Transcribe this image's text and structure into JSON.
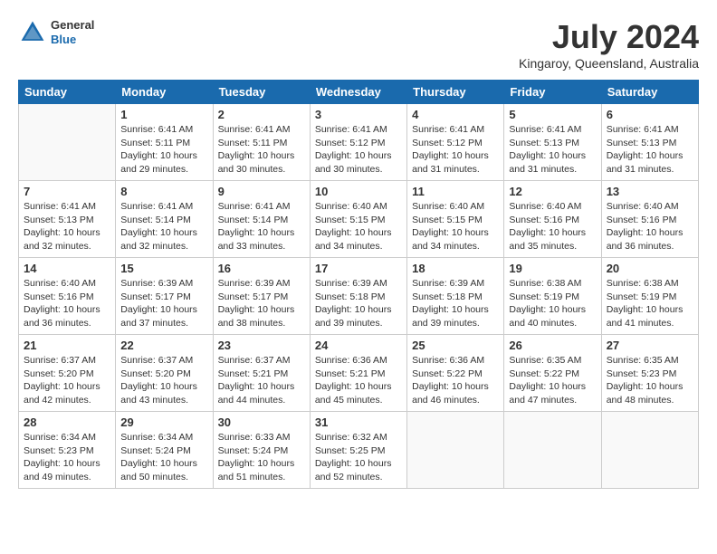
{
  "header": {
    "logo": {
      "general": "General",
      "blue": "Blue"
    },
    "title": "July 2024",
    "location": "Kingaroy, Queensland, Australia"
  },
  "calendar": {
    "days_of_week": [
      "Sunday",
      "Monday",
      "Tuesday",
      "Wednesday",
      "Thursday",
      "Friday",
      "Saturday"
    ],
    "weeks": [
      [
        {
          "day": "",
          "info": ""
        },
        {
          "day": "1",
          "info": "Sunrise: 6:41 AM\nSunset: 5:11 PM\nDaylight: 10 hours\nand 29 minutes."
        },
        {
          "day": "2",
          "info": "Sunrise: 6:41 AM\nSunset: 5:11 PM\nDaylight: 10 hours\nand 30 minutes."
        },
        {
          "day": "3",
          "info": "Sunrise: 6:41 AM\nSunset: 5:12 PM\nDaylight: 10 hours\nand 30 minutes."
        },
        {
          "day": "4",
          "info": "Sunrise: 6:41 AM\nSunset: 5:12 PM\nDaylight: 10 hours\nand 31 minutes."
        },
        {
          "day": "5",
          "info": "Sunrise: 6:41 AM\nSunset: 5:13 PM\nDaylight: 10 hours\nand 31 minutes."
        },
        {
          "day": "6",
          "info": "Sunrise: 6:41 AM\nSunset: 5:13 PM\nDaylight: 10 hours\nand 31 minutes."
        }
      ],
      [
        {
          "day": "7",
          "info": "Sunrise: 6:41 AM\nSunset: 5:13 PM\nDaylight: 10 hours\nand 32 minutes."
        },
        {
          "day": "8",
          "info": "Sunrise: 6:41 AM\nSunset: 5:14 PM\nDaylight: 10 hours\nand 32 minutes."
        },
        {
          "day": "9",
          "info": "Sunrise: 6:41 AM\nSunset: 5:14 PM\nDaylight: 10 hours\nand 33 minutes."
        },
        {
          "day": "10",
          "info": "Sunrise: 6:40 AM\nSunset: 5:15 PM\nDaylight: 10 hours\nand 34 minutes."
        },
        {
          "day": "11",
          "info": "Sunrise: 6:40 AM\nSunset: 5:15 PM\nDaylight: 10 hours\nand 34 minutes."
        },
        {
          "day": "12",
          "info": "Sunrise: 6:40 AM\nSunset: 5:16 PM\nDaylight: 10 hours\nand 35 minutes."
        },
        {
          "day": "13",
          "info": "Sunrise: 6:40 AM\nSunset: 5:16 PM\nDaylight: 10 hours\nand 36 minutes."
        }
      ],
      [
        {
          "day": "14",
          "info": "Sunrise: 6:40 AM\nSunset: 5:16 PM\nDaylight: 10 hours\nand 36 minutes."
        },
        {
          "day": "15",
          "info": "Sunrise: 6:39 AM\nSunset: 5:17 PM\nDaylight: 10 hours\nand 37 minutes."
        },
        {
          "day": "16",
          "info": "Sunrise: 6:39 AM\nSunset: 5:17 PM\nDaylight: 10 hours\nand 38 minutes."
        },
        {
          "day": "17",
          "info": "Sunrise: 6:39 AM\nSunset: 5:18 PM\nDaylight: 10 hours\nand 39 minutes."
        },
        {
          "day": "18",
          "info": "Sunrise: 6:39 AM\nSunset: 5:18 PM\nDaylight: 10 hours\nand 39 minutes."
        },
        {
          "day": "19",
          "info": "Sunrise: 6:38 AM\nSunset: 5:19 PM\nDaylight: 10 hours\nand 40 minutes."
        },
        {
          "day": "20",
          "info": "Sunrise: 6:38 AM\nSunset: 5:19 PM\nDaylight: 10 hours\nand 41 minutes."
        }
      ],
      [
        {
          "day": "21",
          "info": "Sunrise: 6:37 AM\nSunset: 5:20 PM\nDaylight: 10 hours\nand 42 minutes."
        },
        {
          "day": "22",
          "info": "Sunrise: 6:37 AM\nSunset: 5:20 PM\nDaylight: 10 hours\nand 43 minutes."
        },
        {
          "day": "23",
          "info": "Sunrise: 6:37 AM\nSunset: 5:21 PM\nDaylight: 10 hours\nand 44 minutes."
        },
        {
          "day": "24",
          "info": "Sunrise: 6:36 AM\nSunset: 5:21 PM\nDaylight: 10 hours\nand 45 minutes."
        },
        {
          "day": "25",
          "info": "Sunrise: 6:36 AM\nSunset: 5:22 PM\nDaylight: 10 hours\nand 46 minutes."
        },
        {
          "day": "26",
          "info": "Sunrise: 6:35 AM\nSunset: 5:22 PM\nDaylight: 10 hours\nand 47 minutes."
        },
        {
          "day": "27",
          "info": "Sunrise: 6:35 AM\nSunset: 5:23 PM\nDaylight: 10 hours\nand 48 minutes."
        }
      ],
      [
        {
          "day": "28",
          "info": "Sunrise: 6:34 AM\nSunset: 5:23 PM\nDaylight: 10 hours\nand 49 minutes."
        },
        {
          "day": "29",
          "info": "Sunrise: 6:34 AM\nSunset: 5:24 PM\nDaylight: 10 hours\nand 50 minutes."
        },
        {
          "day": "30",
          "info": "Sunrise: 6:33 AM\nSunset: 5:24 PM\nDaylight: 10 hours\nand 51 minutes."
        },
        {
          "day": "31",
          "info": "Sunrise: 6:32 AM\nSunset: 5:25 PM\nDaylight: 10 hours\nand 52 minutes."
        },
        {
          "day": "",
          "info": ""
        },
        {
          "day": "",
          "info": ""
        },
        {
          "day": "",
          "info": ""
        }
      ]
    ]
  }
}
